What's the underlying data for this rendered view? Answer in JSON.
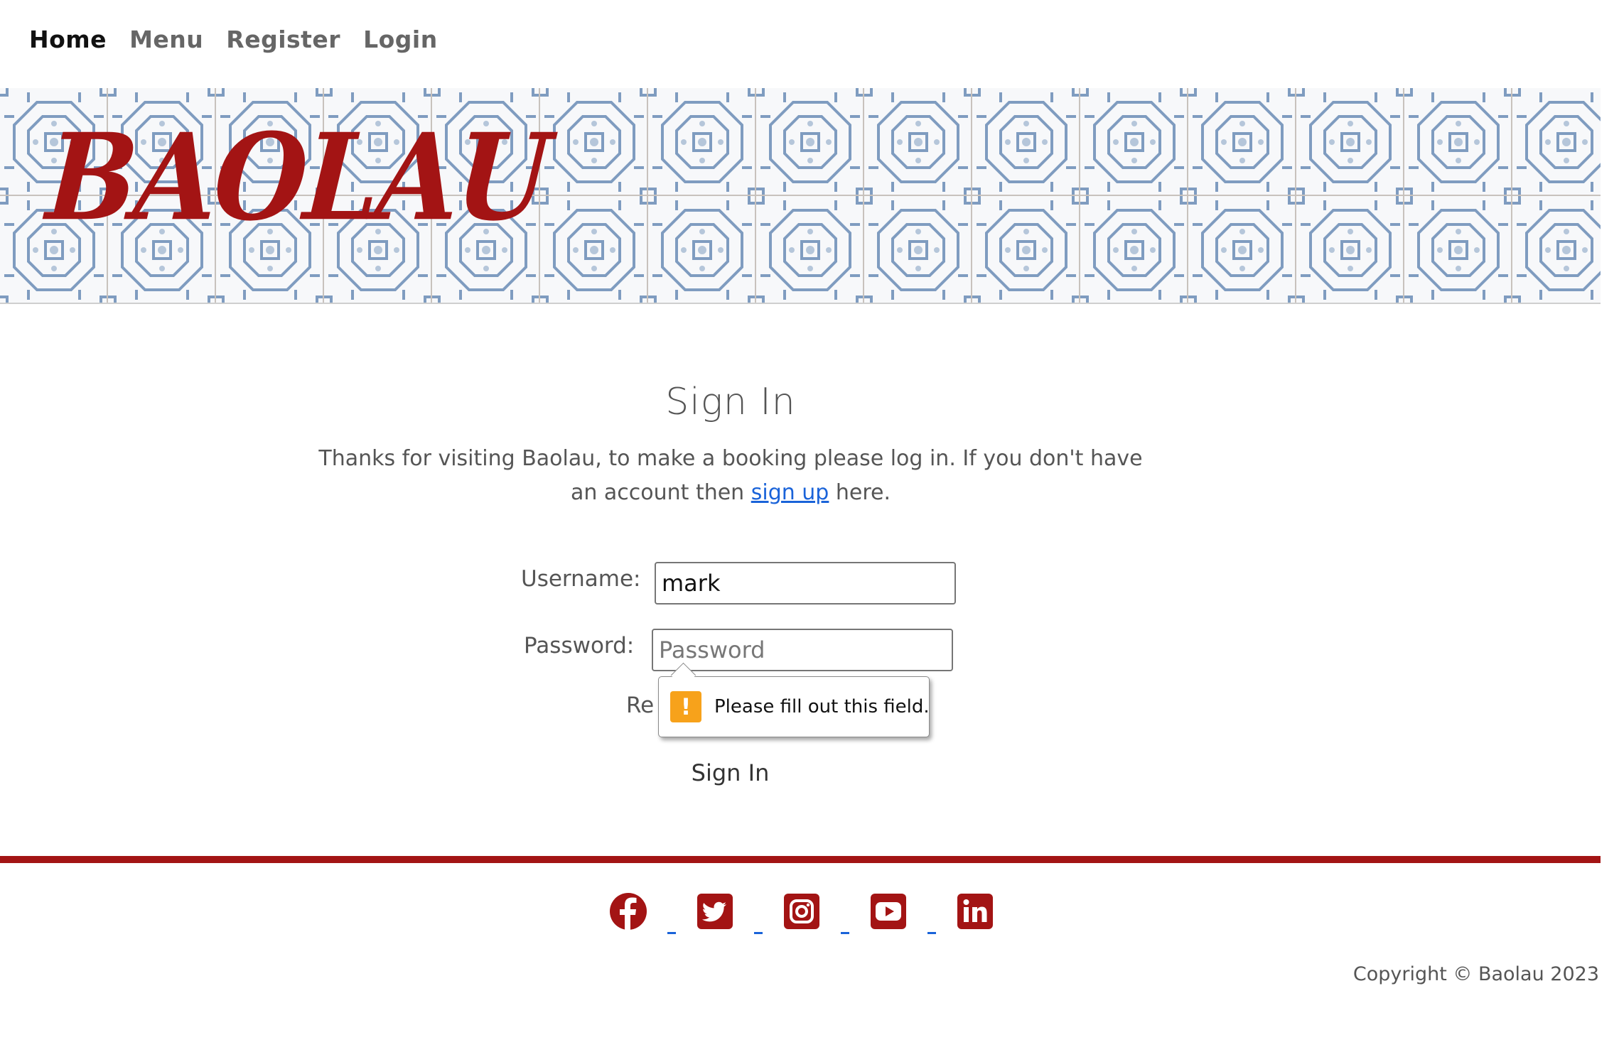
{
  "nav": {
    "items": [
      {
        "label": "Home",
        "active": true
      },
      {
        "label": "Menu",
        "active": false
      },
      {
        "label": "Register",
        "active": false
      },
      {
        "label": "Login",
        "active": false
      }
    ]
  },
  "banner": {
    "brand": "BAOLAU",
    "brand_color": "#a31414",
    "pattern_color": "#7f9cc0"
  },
  "main": {
    "title": "Sign In",
    "intro_before": "Thanks for visiting Baolau, to make a booking please log in. If you don't have an account then ",
    "intro_link": "sign up",
    "intro_after": " here.",
    "username_label": "Username:",
    "username_value": "mark",
    "password_label": "Password:",
    "password_placeholder": "Password",
    "remember_label_partial": "Re",
    "submit_label": "Sign In"
  },
  "validation": {
    "icon": "warning-icon",
    "message": "Please fill out this field."
  },
  "footer": {
    "rule_color": "#a31414",
    "social_icons": [
      "facebook-icon",
      "twitter-icon",
      "instagram-icon",
      "youtube-icon",
      "linkedin-icon"
    ],
    "copyright": "Copyright © Baolau 2023"
  }
}
